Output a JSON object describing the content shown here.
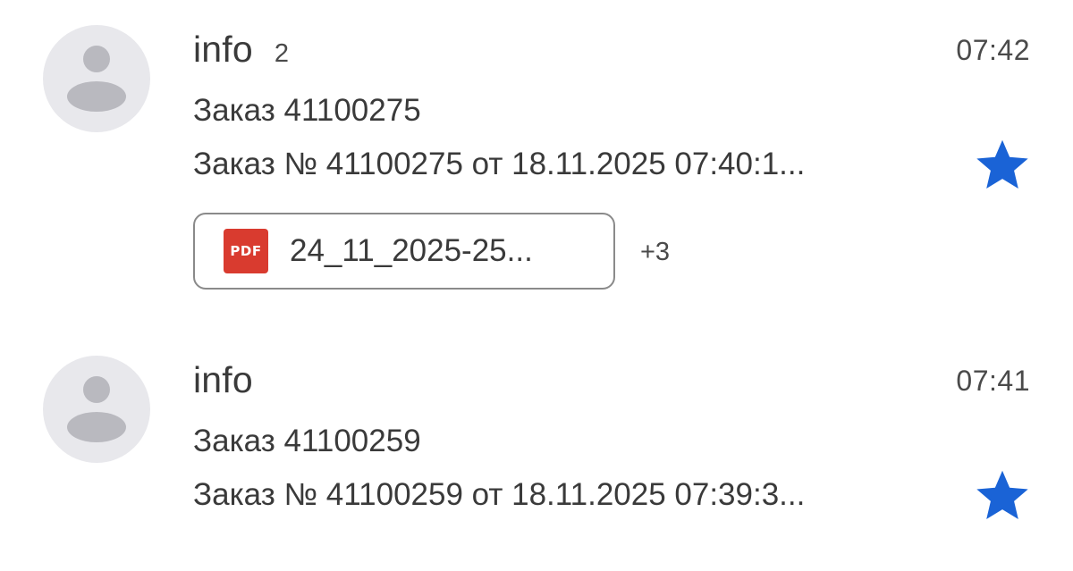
{
  "emails": [
    {
      "sender": "info",
      "count": "2",
      "time": "07:42",
      "subject": "Заказ 41100275",
      "preview": "Заказ № 41100275 от 18.11.2025 07:40:1...",
      "starred": true,
      "attachment": {
        "icon": "pdf-icon",
        "type_label": "PDF",
        "name": "24_11_2025-25...",
        "more": "+3"
      }
    },
    {
      "sender": "info",
      "time": "07:41",
      "subject": "Заказ 41100259",
      "preview": "Заказ № 41100259 от 18.11.2025 07:39:3...",
      "starred": true
    }
  ],
  "colors": {
    "star": "#1a63d6",
    "pdf": "#d93b2f",
    "avatar_bg": "#e8e8ec",
    "avatar_fg": "#b9b9bf"
  }
}
